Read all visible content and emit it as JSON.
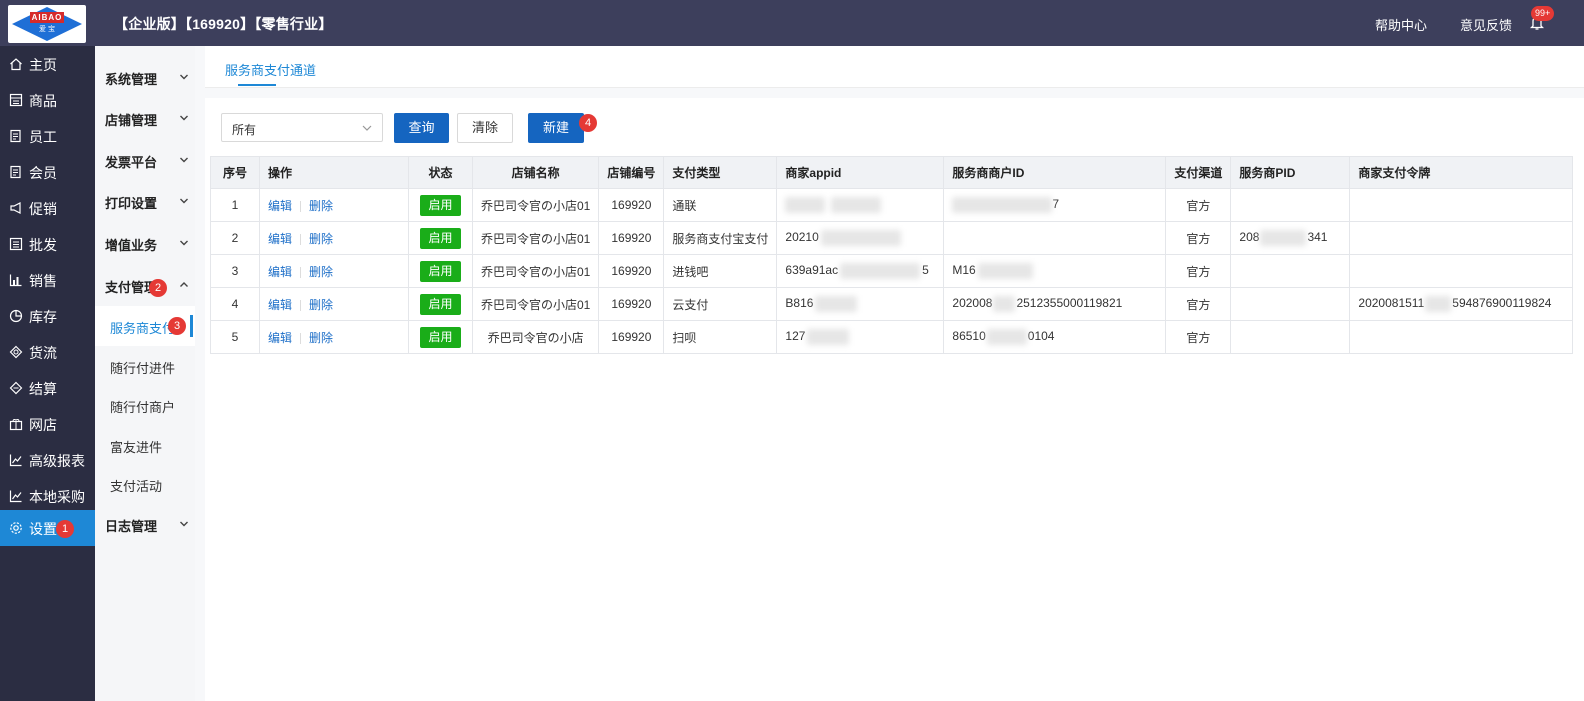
{
  "header": {
    "logo_text": "AIBAO",
    "logo_sub": "爱 宝",
    "title": "【企业版】【169920】【零售行业】",
    "help": "帮助中心",
    "feedback": "意见反馈",
    "notification_count": "99+"
  },
  "nav": {
    "items": [
      {
        "label": "主页",
        "icon": "home-icon"
      },
      {
        "label": "商品",
        "icon": "product-icon"
      },
      {
        "label": "员工",
        "icon": "staff-icon"
      },
      {
        "label": "会员",
        "icon": "member-icon"
      },
      {
        "label": "促销",
        "icon": "promo-icon"
      },
      {
        "label": "批发",
        "icon": "wholesale-icon"
      },
      {
        "label": "销售",
        "icon": "sales-icon"
      },
      {
        "label": "库存",
        "icon": "inventory-icon"
      },
      {
        "label": "货流",
        "icon": "logistics-icon"
      },
      {
        "label": "结算",
        "icon": "settlement-icon"
      },
      {
        "label": "网店",
        "icon": "shop-icon"
      },
      {
        "label": "高级报表",
        "icon": "report-icon"
      },
      {
        "label": "本地采购",
        "icon": "purchase-icon"
      },
      {
        "label": "设置",
        "icon": "gear-icon"
      }
    ],
    "active_badge": "1"
  },
  "subnav": {
    "groups": [
      {
        "label": "系统管理"
      },
      {
        "label": "店铺管理"
      },
      {
        "label": "发票平台"
      },
      {
        "label": "打印设置"
      },
      {
        "label": "增值业务"
      },
      {
        "label": "支付管理"
      }
    ],
    "pay_badge": "2",
    "children": [
      {
        "label": "服务商支付"
      },
      {
        "label": "随行付进件"
      },
      {
        "label": "随行付商户"
      },
      {
        "label": "富友进件"
      },
      {
        "label": "支付活动"
      }
    ],
    "child_badge": "3",
    "log_group": "日志管理"
  },
  "tab": {
    "label": "服务商支付通道"
  },
  "filter": {
    "select_value": "所有",
    "query_label": "查询",
    "clear_label": "清除",
    "new_label": "新建",
    "new_badge": "4"
  },
  "table": {
    "headers": [
      "序号",
      "操作",
      "状态",
      "店铺名称",
      "店铺编号",
      "支付类型",
      "商家appid",
      "服务商商户ID",
      "支付渠道",
      "服务商PID",
      "商家支付令牌"
    ],
    "edit_label": "编辑",
    "delete_label": "删除",
    "status_label": "启用",
    "rows": [
      {
        "no": "1",
        "shop": "乔巴司令官の小店01",
        "code": "169920",
        "type": "通联",
        "appid": "",
        "mid": "7",
        "channel": "官方",
        "pid": "",
        "token": ""
      },
      {
        "no": "2",
        "shop": "乔巴司令官の小店01",
        "code": "169920",
        "type": "服务商支付宝支付",
        "appid": "20210",
        "mid": "",
        "channel": "官方",
        "pid_a": "208",
        "pid_b": "341",
        "token": ""
      },
      {
        "no": "3",
        "shop": "乔巴司令官の小店01",
        "code": "169920",
        "type": "进钱吧",
        "appid_a": "639a91ac",
        "appid_b": "5",
        "mid": "M16",
        "channel": "官方",
        "pid": "",
        "token": ""
      },
      {
        "no": "4",
        "shop": "乔巴司令官の小店01",
        "code": "169920",
        "type": "云支付",
        "appid": "B816",
        "mid_a": "202008",
        "mid_b": "2512355000119821",
        "channel": "官方",
        "pid": "",
        "token_a": "2020081511",
        "token_b": "594876900119824"
      },
      {
        "no": "5",
        "shop": "乔巴司令官の小店",
        "code": "169920",
        "type": "扫呗",
        "appid": "127",
        "mid_a": "86510",
        "mid_b": "0104",
        "channel": "官方",
        "pid": "",
        "token": ""
      }
    ]
  }
}
